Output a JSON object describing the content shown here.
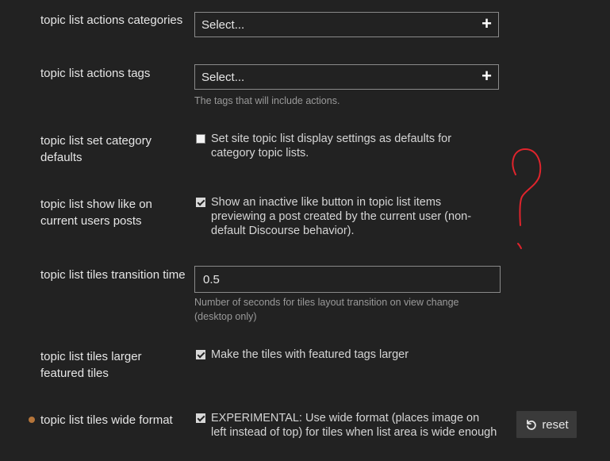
{
  "settings": {
    "categories": {
      "label": "topic list actions categories",
      "placeholder": "Select..."
    },
    "tags": {
      "label": "topic list actions tags",
      "placeholder": "Select...",
      "help": "The tags that will include actions."
    },
    "category_defaults": {
      "label": "topic list set category defaults",
      "checked": false,
      "text": "Set site topic list display settings as defaults for category topic lists."
    },
    "show_like": {
      "label": "topic list show like on current users posts",
      "checked": true,
      "text": "Show an inactive like button in topic list items previewing a post created by the current user (non-default Discourse behavior)."
    },
    "transition_time": {
      "label": "topic list tiles transition time",
      "value": "0.5",
      "help": "Number of seconds for tiles layout transition on view change (desktop only)"
    },
    "larger_featured": {
      "label": "topic list tiles larger featured tiles",
      "checked": true,
      "text": "Make the tiles with featured tags larger"
    },
    "wide_format": {
      "label": "topic list tiles wide format",
      "checked": true,
      "text": "EXPERIMENTAL: Use wide format (places image on left instead of top) for tiles when list area is wide enough",
      "reset_label": "reset"
    }
  },
  "colors": {
    "background": "#222222",
    "modified_dot": "#b5753a",
    "annotation": "#e0242c"
  },
  "icons": {
    "add": "plus-icon",
    "reset": "undo-icon"
  }
}
